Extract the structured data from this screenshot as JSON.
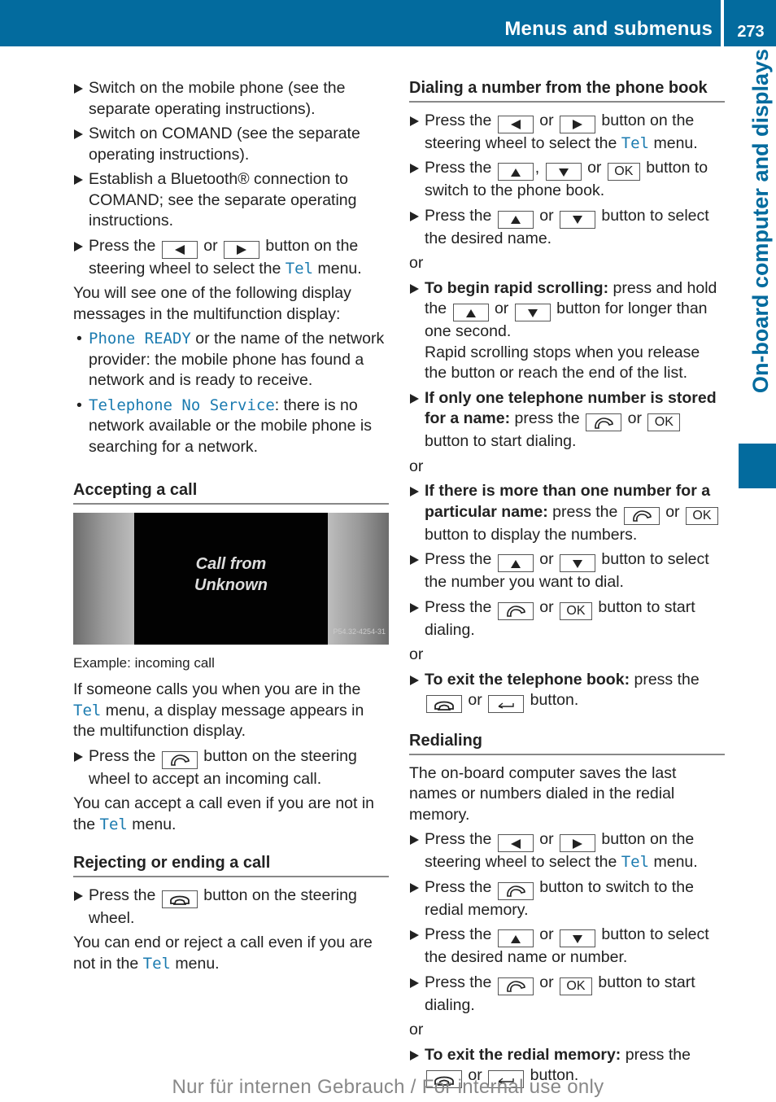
{
  "header": {
    "title": "Menus and submenus",
    "page_number": "273",
    "side_tab": "On-board computer and displays",
    "color": "#036b9e"
  },
  "left": {
    "steps_intro": [
      "Switch on the mobile phone (see the separate operating instructions).",
      "Switch on COMAND (see the separate operating instructions).",
      "Establish a Bluetooth® connection to COMAND; see the separate operating instructions."
    ],
    "step_tel": {
      "pre": "Press the",
      "or": "or",
      "post": "button on the steering wheel to select the",
      "tel": "Tel",
      "end": "menu."
    },
    "display_msg_intro": "You will see one of the following display messages in the multifunction display:",
    "bullets": [
      {
        "code": "Phone READY",
        "text": " or the name of the network provider: the mobile phone has found a network and is ready to receive."
      },
      {
        "code": "Telephone No Service",
        "text": ": there is no network available or the mobile phone is searching for a network."
      }
    ],
    "accepting": {
      "heading": "Accepting a call",
      "figure_line1": "Call from",
      "figure_line2": "Unknown",
      "figure_code": "P54.32-4254-31",
      "caption": "Example: incoming call",
      "para1_pre": "If someone calls you when you are in the",
      "para1_post": "menu, a display message appears in the multifunction display.",
      "step_pre": "Press the",
      "step_post": "button on the steering wheel to accept an incoming call.",
      "para2_pre": "You can accept a call even if you are not in the",
      "para2_post": "menu."
    },
    "rejecting": {
      "heading": "Rejecting or ending a call",
      "step_pre": "Press the",
      "step_post": "button on the steering wheel.",
      "para_pre": "You can end or reject a call even if you are not in the",
      "para_post": "menu."
    },
    "tel": "Tel"
  },
  "right": {
    "phonebook": {
      "heading": "Dialing a number from the phone book",
      "s1_pre": "Press the",
      "s1_post": "button on the steering wheel to select the",
      "s1_end": "menu.",
      "s2_pre": "Press the",
      "s2_post": "button to switch to the phone book.",
      "s3_pre": "Press the",
      "s3_post": "button to select the desired name.",
      "rapid_bold": "To begin rapid scrolling:",
      "rapid_pre": "press and hold the",
      "rapid_post": "button for longer than one second.",
      "rapid_note": "Rapid scrolling stops when you release the button or reach the end of the list.",
      "one_bold": "If only one telephone number is stored for a name:",
      "one_pre": "press the",
      "one_post": "button to start dialing.",
      "more_bold": "If there is more than one number for a particular name:",
      "more_pre": "press the",
      "more_post": "button to display the numbers.",
      "s4_pre": "Press the",
      "s4_post": "button to select the number you want to dial.",
      "s5_pre": "Press the",
      "s5_post": "button to start dialing.",
      "exit_bold": "To exit the telephone book:",
      "exit_pre": "press the",
      "exit_post": "button."
    },
    "redial": {
      "heading": "Redialing",
      "intro": "The on-board computer saves the last names or numbers dialed in the redial memory.",
      "s1_pre": "Press the",
      "s1_post": "button on the steering wheel to select the",
      "s1_end": "menu.",
      "s2_pre": "Press the",
      "s2_post": "button to switch to the redial memory.",
      "s3_pre": "Press the",
      "s3_post": "button to select the desired name or number.",
      "s4_pre": "Press the",
      "s4_post": "button to start dialing.",
      "exit_bold": "To exit the redial memory:",
      "exit_pre": "press the",
      "exit_post": "button."
    },
    "or": "or",
    "tel": "Tel"
  },
  "keys": {
    "ok": "OK",
    "or": "or",
    "comma": ","
  },
  "footer": "Nur für internen Gebrauch / For internal use only"
}
